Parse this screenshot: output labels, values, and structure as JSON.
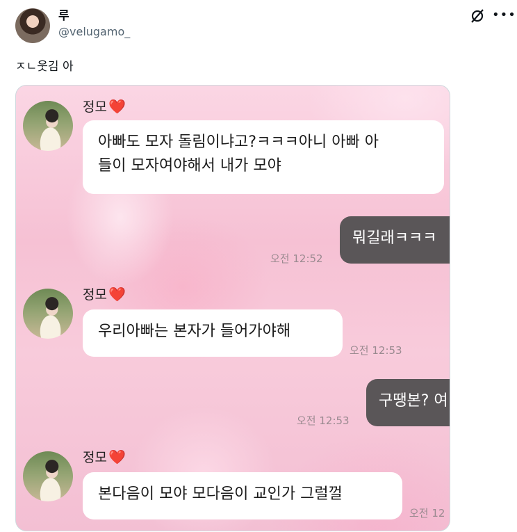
{
  "post": {
    "author_name": "루",
    "author_handle": "@velugamo_",
    "text": "ㅈㄴ웃김 아"
  },
  "chat": {
    "messages": [
      {
        "sender": "정모",
        "heart": "❤️",
        "text_line1": "아빠도 모자 돌림이냐고?ㅋㅋㅋ아니 아빠 아",
        "text_line2": "들이 모자여야해서 내가 모야"
      },
      {
        "text": "뭐길래ㅋㅋㅋ",
        "time": "오전 12:52"
      },
      {
        "sender": "정모",
        "heart": "❤️",
        "text": "우리아빠는 본자가 들어가야해",
        "time": "오전 12:53"
      },
      {
        "text": "구땡본? 여",
        "time": "오전 12:53"
      },
      {
        "sender": "정모",
        "heart": "❤️",
        "text": "본다음이 모야 모다음이 교인가 그럴껄",
        "time": "오전 12"
      }
    ]
  },
  "icons": {
    "grok": "grok-icon",
    "more": "more-icon"
  }
}
